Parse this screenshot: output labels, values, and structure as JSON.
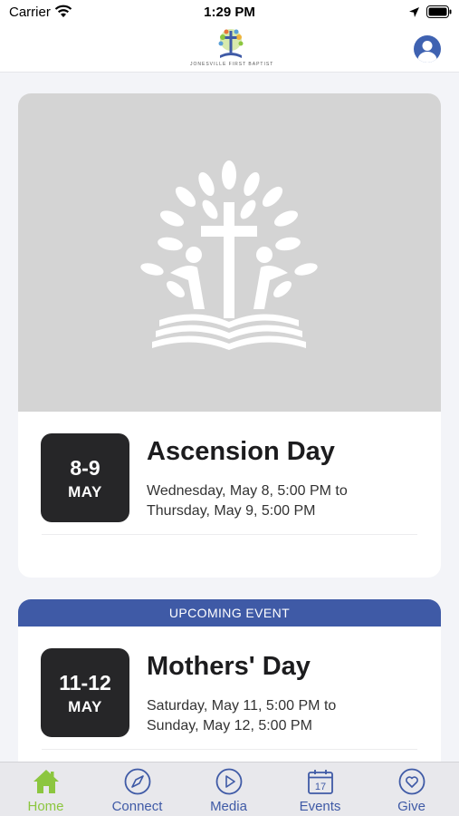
{
  "status_bar": {
    "carrier": "Carrier",
    "time": "1:29 PM"
  },
  "header": {
    "logo_text": "JONESVILLE FIRST BAPTIST"
  },
  "featured_event": {
    "date_range": "8-9",
    "month": "MAY",
    "title": "Ascension Day",
    "time_line1": "Wednesday, May 8, 5:00 PM to",
    "time_line2": "Thursday, May 9, 5:00 PM"
  },
  "upcoming_event": {
    "banner": "UPCOMING EVENT",
    "date_range": "11-12",
    "month": "MAY",
    "title": "Mothers' Day",
    "time_line1": "Saturday, May 11, 5:00 PM to",
    "time_line2": "Sunday, May 12, 5:00 PM"
  },
  "tabs": [
    {
      "label": "Home",
      "icon": "home-icon",
      "active": true
    },
    {
      "label": "Connect",
      "icon": "compass-icon",
      "active": false
    },
    {
      "label": "Media",
      "icon": "play-icon",
      "active": false
    },
    {
      "label": "Events",
      "icon": "calendar-icon",
      "active": false
    },
    {
      "label": "Give",
      "icon": "heart-icon",
      "active": false
    }
  ],
  "colors": {
    "accent_blue": "#3f5aa6",
    "active_green": "#8cc63f",
    "badge_dark": "#262628"
  }
}
